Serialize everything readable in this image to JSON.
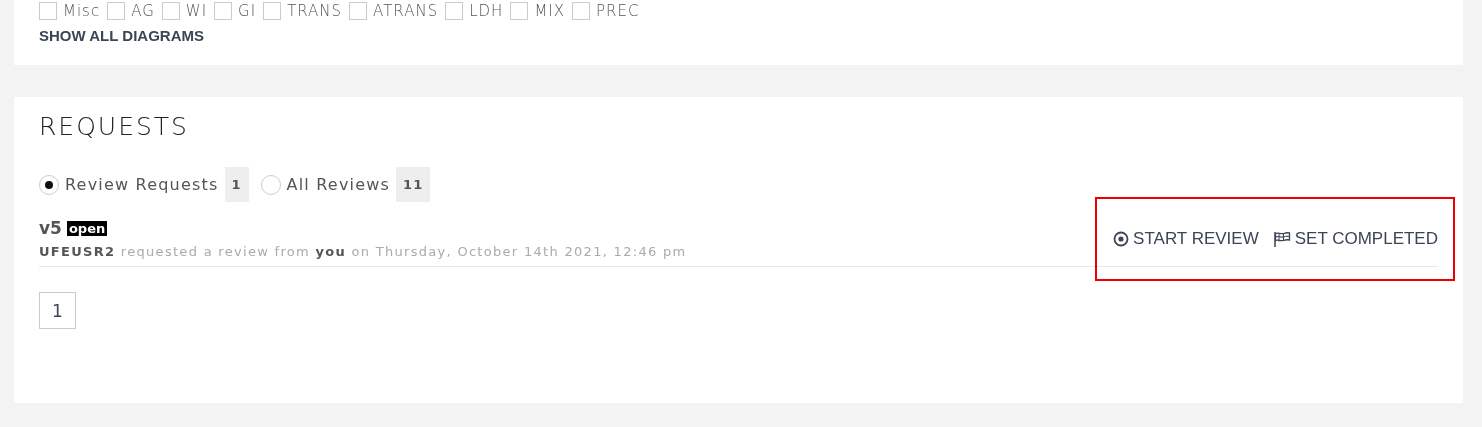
{
  "diagram_filters": [
    {
      "label": "Misc",
      "checked": false
    },
    {
      "label": "AG",
      "checked": false
    },
    {
      "label": "WI",
      "checked": false
    },
    {
      "label": "GI",
      "checked": false
    },
    {
      "label": "TRANS",
      "checked": false
    },
    {
      "label": "ATRANS",
      "checked": false
    },
    {
      "label": "LDH",
      "checked": false
    },
    {
      "label": "MIX",
      "checked": false
    },
    {
      "label": "PREC",
      "checked": false
    }
  ],
  "show_all_link": "SHOW ALL DIAGRAMS",
  "requests": {
    "title": "REQUESTS",
    "filters": [
      {
        "label": "Review Requests",
        "count": "1",
        "selected": true
      },
      {
        "label": "All Reviews",
        "count": "11",
        "selected": false
      }
    ],
    "items": [
      {
        "version": "v5",
        "status": "open",
        "description": "**UFEUSR2** requested a review from **you** on Thursday, October 14th 2021, 12:46 pm",
        "actions_highlighted": true,
        "actions": [
          {
            "kind": "start",
            "label": "START REVIEW"
          },
          {
            "kind": "complete",
            "label": "SET COMPLETED"
          }
        ]
      }
    ],
    "pages": [
      "1"
    ]
  }
}
